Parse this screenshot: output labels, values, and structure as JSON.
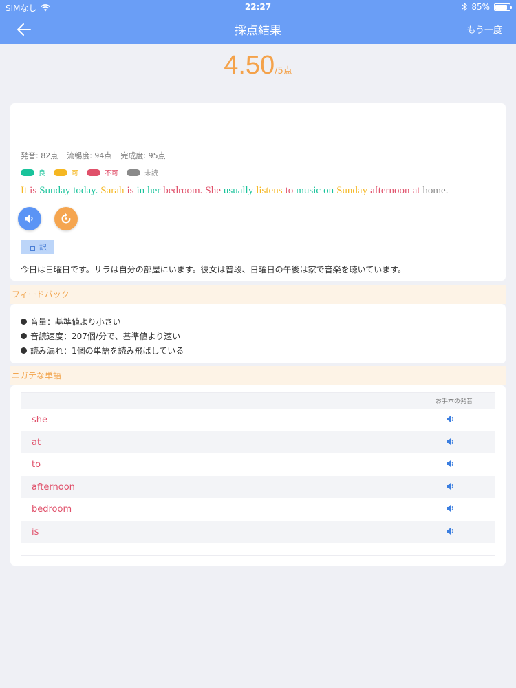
{
  "status_bar": {
    "carrier": "SIMなし",
    "time": "22:27",
    "battery": "85%",
    "battery_level": 0.85
  },
  "nav": {
    "title": "採点結果",
    "retry_label": "もう一度"
  },
  "score": {
    "value": "4.50",
    "suffix": "/5点"
  },
  "metrics": [
    "発音: 82点",
    "流暢度: 94点",
    "完成度: 95点"
  ],
  "legend": [
    {
      "label": "良",
      "color": "#19c39b"
    },
    {
      "label": "可",
      "color": "#f5b722"
    },
    {
      "label": "不可",
      "color": "#e0506a"
    },
    {
      "label": "未読",
      "color": "#8a8a8a"
    }
  ],
  "sentence": [
    {
      "text": "It",
      "color": "#f5b722"
    },
    {
      "text": "is",
      "color": "#e0506a"
    },
    {
      "text": "Sunday",
      "color": "#19c39b"
    },
    {
      "text": "today.",
      "color": "#19c39b"
    },
    {
      "text": "Sarah",
      "color": "#f5b722"
    },
    {
      "text": "is",
      "color": "#e0506a"
    },
    {
      "text": "in",
      "color": "#19c39b"
    },
    {
      "text": "her",
      "color": "#19c39b"
    },
    {
      "text": "bedroom.",
      "color": "#e0506a"
    },
    {
      "text": "She",
      "color": "#e0506a"
    },
    {
      "text": "usually",
      "color": "#19c39b"
    },
    {
      "text": "listens",
      "color": "#f5b722"
    },
    {
      "text": "to",
      "color": "#e0506a"
    },
    {
      "text": "music",
      "color": "#19c39b"
    },
    {
      "text": "on",
      "color": "#19c39b"
    },
    {
      "text": "Sunday",
      "color": "#f5b722"
    },
    {
      "text": "afternoon",
      "color": "#e0506a"
    },
    {
      "text": "at",
      "color": "#e0506a"
    },
    {
      "text": "home.",
      "color": "#8a8a8a"
    }
  ],
  "translate_label": "訳",
  "translation": "今日は日曜日です。サラは自分の部屋にいます。彼女は普段、日曜日の午後は家で音楽を聴いています。",
  "feedback": {
    "heading": "フィードバック",
    "items": [
      "音量：基準値より小さい",
      "音読速度：207個/分で、基準値より速い",
      "読み漏れ：1個の単語を読み飛ばしている"
    ]
  },
  "weak_words": {
    "heading": "ニガテな単語",
    "column_label": "お手本の発音",
    "words": [
      "she",
      "at",
      "to",
      "afternoon",
      "bedroom",
      "is"
    ]
  }
}
